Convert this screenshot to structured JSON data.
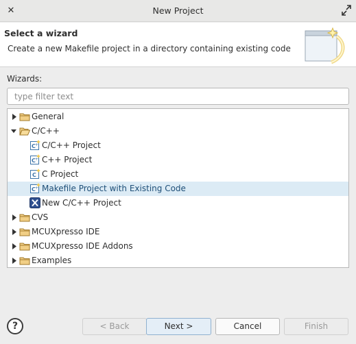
{
  "window": {
    "title": "New Project"
  },
  "header": {
    "title": "Select a wizard",
    "description": "Create a new Makefile project in a directory containing existing code"
  },
  "wizards": {
    "label": "Wizards:",
    "filter_placeholder": "type filter text",
    "tree": [
      {
        "label": "General",
        "type": "folder",
        "expanded": false,
        "level": 0,
        "selected": false
      },
      {
        "label": "C/C++",
        "type": "folder",
        "expanded": true,
        "level": 0,
        "selected": false
      },
      {
        "label": "C/C++ Project",
        "type": "cpp-project-icon",
        "level": 1,
        "selected": false
      },
      {
        "label": "C++ Project",
        "type": "cpp-project-icon",
        "level": 1,
        "selected": false
      },
      {
        "label": "C Project",
        "type": "c-project-icon",
        "level": 1,
        "selected": false
      },
      {
        "label": "Makefile Project with Existing Code",
        "type": "makefile-project-icon",
        "level": 1,
        "selected": true
      },
      {
        "label": "New C/C++ Project",
        "type": "new-cpp-project-icon",
        "level": 1,
        "selected": false
      },
      {
        "label": "CVS",
        "type": "folder",
        "expanded": false,
        "level": 0,
        "selected": false
      },
      {
        "label": "MCUXpresso IDE",
        "type": "folder",
        "expanded": false,
        "level": 0,
        "selected": false
      },
      {
        "label": "MCUXpresso IDE Addons",
        "type": "folder",
        "expanded": false,
        "level": 0,
        "selected": false
      },
      {
        "label": "Examples",
        "type": "folder",
        "expanded": false,
        "level": 0,
        "selected": false
      }
    ]
  },
  "footer": {
    "help_symbol": "?",
    "back": "< Back",
    "next": "Next >",
    "cancel": "Cancel",
    "finish": "Finish"
  },
  "colors": {
    "selection": "#dcebf5",
    "accent": "#3b73a8"
  }
}
